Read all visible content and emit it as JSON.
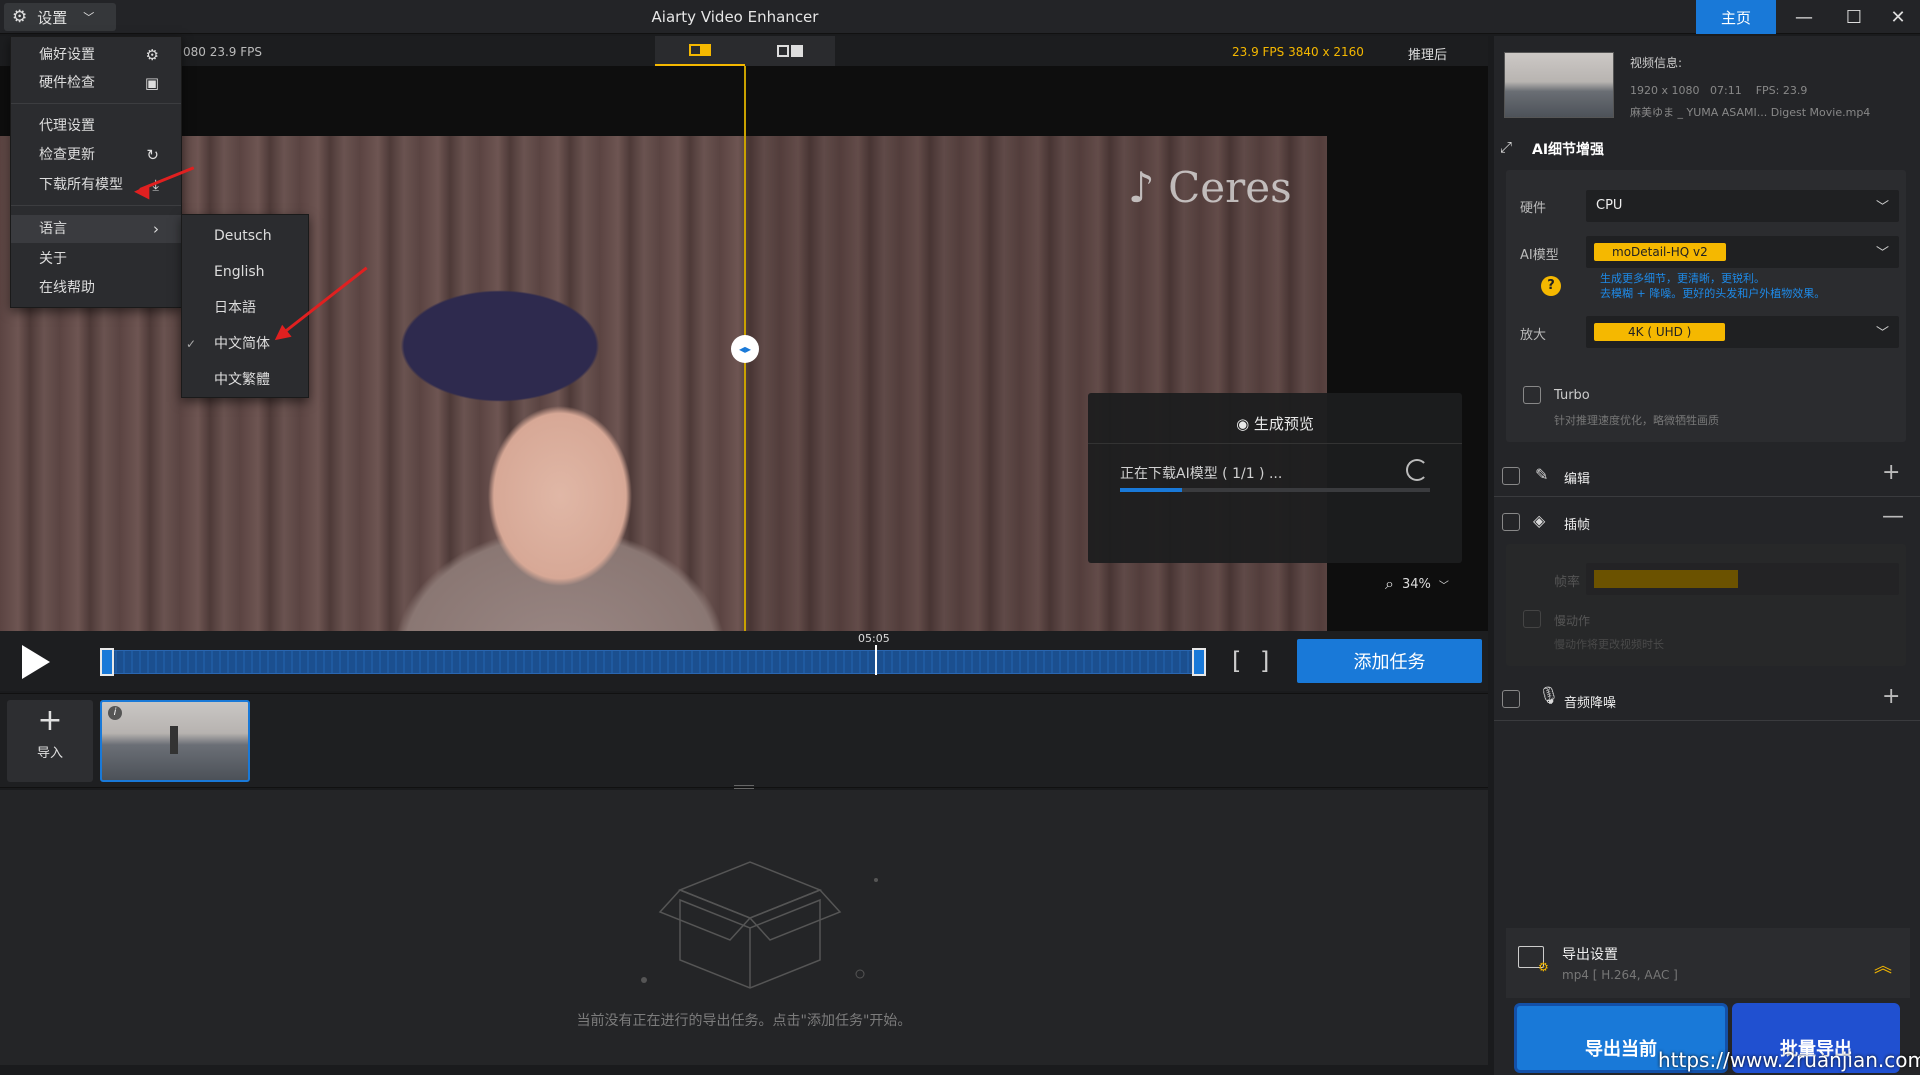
{
  "window": {
    "title": "Aiarty Video Enhancer",
    "settings_label": "设置",
    "home_label": "主页"
  },
  "preview": {
    "left_info": "080  23.9 FPS",
    "right_info": "23.9 FPS  3840 x 2160",
    "right_tag": "推理后",
    "watermark": "♪ Ceres",
    "zoom": "34%"
  },
  "gen_preview": {
    "title": "生成预览",
    "status": "正在下载AI模型 ( 1/1 ) ...",
    "progress": 0.2
  },
  "timeline": {
    "time": "05:05",
    "add_task": "添加任务",
    "bracket_in": "[",
    "bracket_out": "]"
  },
  "clips": {
    "import_label": "导入"
  },
  "tasks": {
    "empty_text": "当前没有正在进行的导出任务。点击\"添加任务\"开始。"
  },
  "video_info": {
    "heading": "视频信息:",
    "resolution": "1920 x 1080",
    "duration": "07:11",
    "fps": "FPS: 23.9",
    "filename": "麻美ゆま _ YUMA ASAMI... Digest Movie.mp4"
  },
  "ai_detail": {
    "heading": "AI细节增强",
    "hardware_label": "硬件",
    "hardware_value": "CPU",
    "model_label": "AI模型",
    "model_value": "moDetail-HQ  v2",
    "model_desc_1": "生成更多细节，更清晰，更锐利。",
    "model_desc_2": "去模糊 + 降噪。更好的头发和户外植物效果。",
    "upscale_label": "放大",
    "upscale_value": "4K ( UHD )",
    "turbo_label": "Turbo",
    "turbo_desc": "针对推理速度优化，略微牺牲画质"
  },
  "modules": {
    "edit_label": "编辑",
    "interp_label": "插帧",
    "framerate_label": "帧率",
    "slowmo_label": "慢动作",
    "slowmo_desc": "慢动作将更改视频时长",
    "audio_label": "音频降噪"
  },
  "export": {
    "heading": "导出设置",
    "format": "mp4 [ H.264, AAC ]",
    "export_current": "导出当前",
    "batch_export": "批量导出"
  },
  "settings_menu": {
    "items": [
      {
        "label": "偏好设置"
      },
      {
        "label": "硬件检查"
      },
      {
        "label": "代理设置"
      },
      {
        "label": "检查更新"
      },
      {
        "label": "下载所有模型"
      },
      {
        "label": "语言"
      },
      {
        "label": "关于"
      },
      {
        "label": "在线帮助"
      }
    ]
  },
  "language_menu": {
    "items": [
      "Deutsch",
      "English",
      "日本語",
      "中文简体",
      "中文繁體"
    ],
    "selected": "中文简体"
  },
  "overlay_url": "https://www.2ruanjian.com",
  "colors": {
    "accent": "#1979d8",
    "highlight": "#f5b800",
    "annotation_arrow": "#e02020"
  }
}
